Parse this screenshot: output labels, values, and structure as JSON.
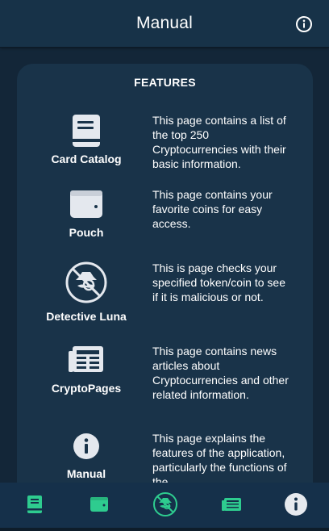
{
  "header": {
    "title": "Manual",
    "info_icon": "info-circle-icon"
  },
  "card": {
    "section_title": "FEATURES",
    "features": [
      {
        "icon": "book-icon",
        "label": "Card Catalog",
        "description": "This page contains a list of the top 250 Cryptocurrencies with their basic information."
      },
      {
        "icon": "wallet-icon",
        "label": "Pouch",
        "description": "This page contains your favorite coins for easy access."
      },
      {
        "icon": "detective-icon",
        "label": "Detective Luna",
        "description": "This is page checks your specified token/coin to see if it is malicious or not."
      },
      {
        "icon": "newspaper-icon",
        "label": "CryptoPages",
        "description": "This page contains news articles about Cryptocurrencies and other related information."
      },
      {
        "icon": "info-circle-icon",
        "label": "Manual",
        "description": "This page explains the features of the application, particularly the functions of the"
      }
    ]
  },
  "bottom_nav": {
    "items": [
      {
        "icon": "book-icon",
        "color": "#2ecc8f"
      },
      {
        "icon": "wallet-icon",
        "color": "#2ecc8f"
      },
      {
        "icon": "detective-icon",
        "color": "#2ecc8f"
      },
      {
        "icon": "newspaper-icon",
        "color": "#2ecc8f"
      },
      {
        "icon": "info-circle-icon",
        "color": "#e6e9ee"
      }
    ]
  },
  "colors": {
    "background": "#132638",
    "header": "#173248",
    "card": "#193349",
    "accent_green": "#2ecc8f",
    "icon_light": "#e4e8ee"
  }
}
